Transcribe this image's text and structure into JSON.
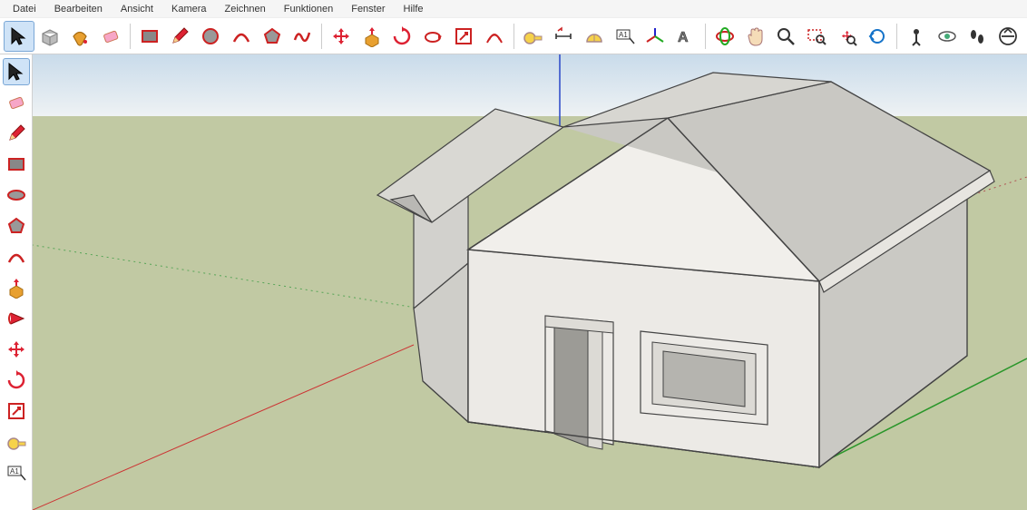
{
  "menu": {
    "items": [
      "Datei",
      "Bearbeiten",
      "Ansicht",
      "Kamera",
      "Zeichnen",
      "Funktionen",
      "Fenster",
      "Hilfe"
    ]
  },
  "toolbar_top": {
    "groups": [
      [
        {
          "name": "select-tool",
          "icon": "cursor",
          "selected": true
        },
        {
          "name": "make-component",
          "icon": "cube"
        },
        {
          "name": "paint-bucket",
          "icon": "bucket"
        },
        {
          "name": "eraser",
          "icon": "eraser"
        }
      ],
      [
        {
          "name": "rectangle-tool",
          "icon": "rect"
        },
        {
          "name": "line-tool",
          "icon": "pencil"
        },
        {
          "name": "circle-tool",
          "icon": "circle"
        },
        {
          "name": "arc-tool",
          "icon": "arc"
        },
        {
          "name": "polygon-tool",
          "icon": "polygon"
        },
        {
          "name": "freehand-tool",
          "icon": "squig"
        }
      ],
      [
        {
          "name": "move-tool",
          "icon": "move4"
        },
        {
          "name": "push-pull-tool",
          "icon": "pushpull"
        },
        {
          "name": "rotate-tool",
          "icon": "rotate"
        },
        {
          "name": "follow-me-tool",
          "icon": "follow"
        },
        {
          "name": "scale-tool",
          "icon": "scale"
        },
        {
          "name": "offset-tool",
          "icon": "offset"
        }
      ],
      [
        {
          "name": "tape-measure-tool",
          "icon": "tape"
        },
        {
          "name": "dimension-tool",
          "icon": "dim"
        },
        {
          "name": "protractor-tool",
          "icon": "protractor"
        },
        {
          "name": "text-tool",
          "icon": "text"
        },
        {
          "name": "axes-tool",
          "icon": "axes"
        },
        {
          "name": "3d-text-tool",
          "icon": "text3d"
        }
      ],
      [
        {
          "name": "orbit-tool",
          "icon": "orbit"
        },
        {
          "name": "pan-tool",
          "icon": "hand"
        },
        {
          "name": "zoom-tool",
          "icon": "zoom"
        },
        {
          "name": "zoom-window-tool",
          "icon": "zoomwin"
        },
        {
          "name": "zoom-extents-tool",
          "icon": "zoomext"
        },
        {
          "name": "previous-view",
          "icon": "prevview"
        }
      ],
      [
        {
          "name": "position-camera",
          "icon": "camerapos"
        },
        {
          "name": "look-around",
          "icon": "eye"
        },
        {
          "name": "walk-tool",
          "icon": "feet"
        },
        {
          "name": "section-plane",
          "icon": "section"
        }
      ]
    ]
  },
  "toolbar_left": {
    "items": [
      {
        "name": "select-tool",
        "icon": "cursor",
        "selected": true
      },
      {
        "name": "eraser",
        "icon": "eraser"
      },
      {
        "name": "line-tool",
        "icon": "pencil"
      },
      {
        "name": "rectangle-tool",
        "icon": "rect"
      },
      {
        "name": "circle-tool",
        "icon": "circ-side"
      },
      {
        "name": "polygon-tool",
        "icon": "polygon"
      },
      {
        "name": "arc-tool",
        "icon": "arc"
      },
      {
        "name": "push-pull-tool",
        "icon": "pushpull"
      },
      {
        "name": "follow-me-tool",
        "icon": "followside"
      },
      {
        "name": "move-tool",
        "icon": "move4"
      },
      {
        "name": "rotate-tool",
        "icon": "rotate"
      },
      {
        "name": "scale-tool",
        "icon": "scale"
      },
      {
        "name": "tape-measure-tool",
        "icon": "tape"
      },
      {
        "name": "text-tool",
        "icon": "text"
      }
    ]
  },
  "viewport": {
    "sky_top": "#d9e4f0",
    "sky_bottom": "#f4f6f8",
    "ground": "#c1c9a3",
    "axis_x": "#c33",
    "axis_y": "#2a962a",
    "axis_z": "#2846c8"
  }
}
